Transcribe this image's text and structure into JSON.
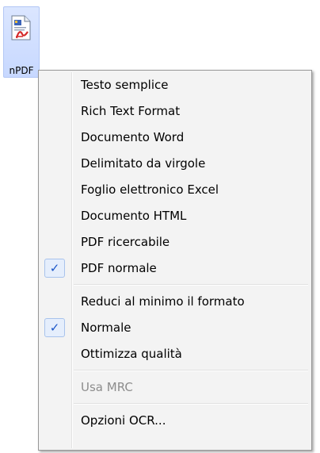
{
  "desktop_icon": {
    "label": "nPDF",
    "icon": "pdf-document-icon"
  },
  "menu": {
    "groups": [
      {
        "items": [
          {
            "label": "Testo semplice",
            "checked": false,
            "disabled": false
          },
          {
            "label": "Rich Text Format",
            "checked": false,
            "disabled": false
          },
          {
            "label": "Documento Word",
            "checked": false,
            "disabled": false
          },
          {
            "label": "Delimitato da virgole",
            "checked": false,
            "disabled": false
          },
          {
            "label": "Foglio elettronico Excel",
            "checked": false,
            "disabled": false
          },
          {
            "label": "Documento HTML",
            "checked": false,
            "disabled": false
          },
          {
            "label": "PDF ricercabile",
            "checked": false,
            "disabled": false
          },
          {
            "label": "PDF normale",
            "checked": true,
            "disabled": false
          }
        ]
      },
      {
        "items": [
          {
            "label": "Reduci al minimo il formato",
            "checked": false,
            "disabled": false
          },
          {
            "label": "Normale",
            "checked": true,
            "disabled": false
          },
          {
            "label": "Ottimizza qualità",
            "checked": false,
            "disabled": false
          }
        ]
      },
      {
        "items": [
          {
            "label": "Usa MRC",
            "checked": false,
            "disabled": true
          }
        ]
      },
      {
        "items": [
          {
            "label": "Opzioni OCR...",
            "checked": false,
            "disabled": false
          }
        ]
      }
    ],
    "check_glyph": "✓",
    "colors": {
      "menu_background": "#f3f3f3",
      "check_highlight": "#e5eefc",
      "check_mark": "#1a55c8",
      "disabled_text": "#8d8d8d"
    }
  }
}
